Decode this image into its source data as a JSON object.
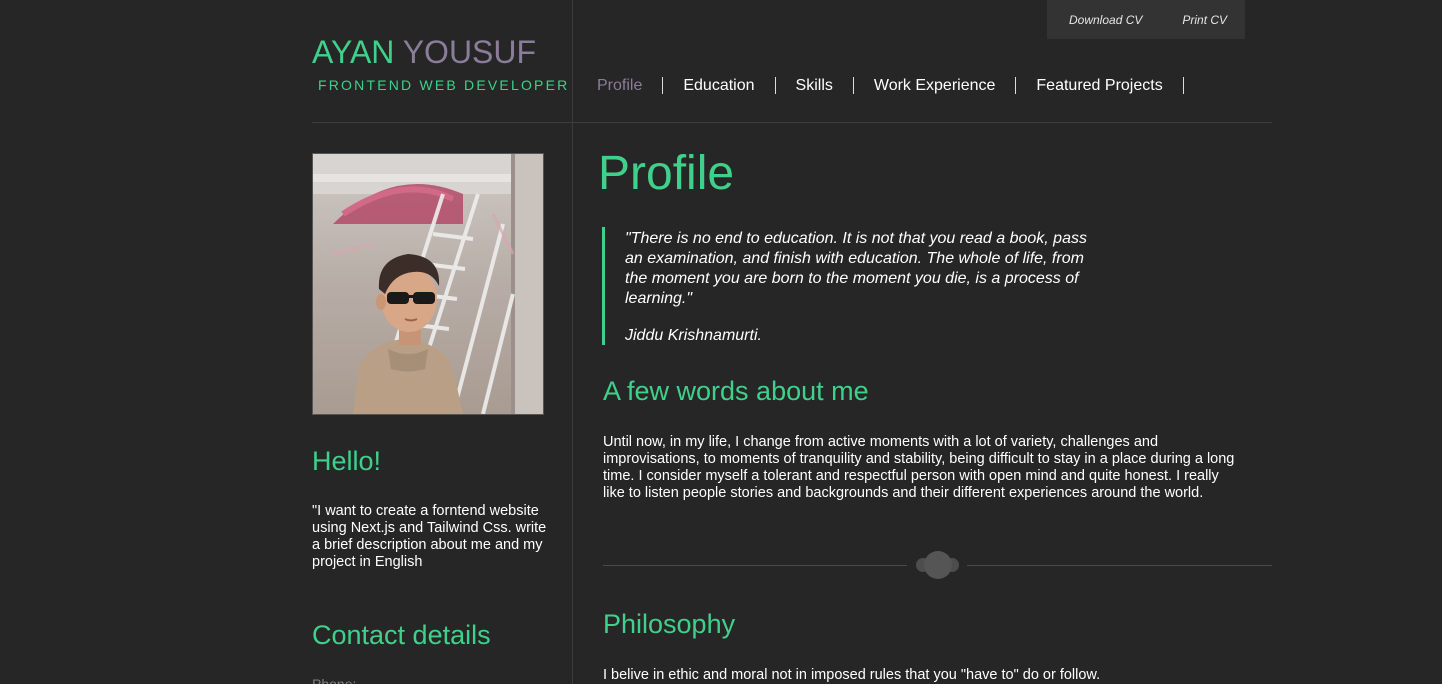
{
  "header": {
    "name_first": "AYAN",
    "name_last": "YOUSUF",
    "role": "FRONTEND WEB DEVELOPER",
    "actions": {
      "download_label": "Download CV",
      "print_label": "Print CV"
    }
  },
  "nav": {
    "items": [
      {
        "label": "Profile",
        "active": true
      },
      {
        "label": "Education",
        "active": false
      },
      {
        "label": "Skills",
        "active": false
      },
      {
        "label": "Work Experience",
        "active": false
      },
      {
        "label": "Featured Projects",
        "active": false
      }
    ]
  },
  "sidebar": {
    "hello_title": "Hello!",
    "hello_text": "\"I want to create a forntend website using Next.js and Tailwind Css. write a brief description about me and my project in English",
    "contact_title": "Contact details",
    "phone_label": "Phone:"
  },
  "main": {
    "title": "Profile",
    "quote": {
      "text": "\"There is no end to education. It is not that you read a book, pass an examination, and finish with education. The whole of life, from the moment you are born to the moment you die, is a process of learning.\"",
      "author": "Jiddu Krishnamurti."
    },
    "about_title": "A few words about me",
    "about_text": "Until now, in my life, I change from active moments with a lot of variety, challenges and improvisations, to moments of tranquility and stability, being difficult to stay in a place during a long time. I consider myself a tolerant and respectful person with open mind and quite honest. I really like to listen people stories and backgrounds and their different experiences around the world.",
    "philosophy_title": "Philosophy",
    "philosophy_text": "I belive in ethic and moral not in imposed rules that you \"have to\" do or follow."
  },
  "colors": {
    "background": "#262626",
    "accent": "#3fd18b",
    "muted_purple": "#8a7d99",
    "text": "#ffffff"
  }
}
